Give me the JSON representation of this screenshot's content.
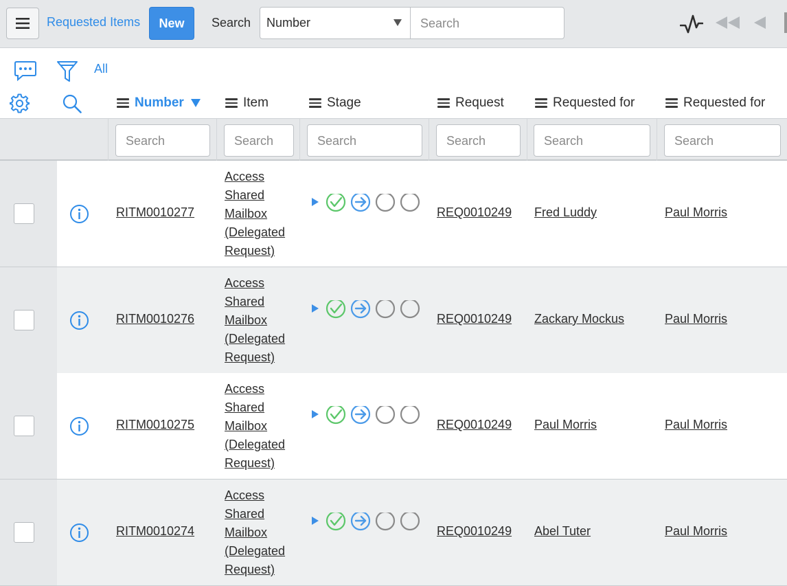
{
  "header": {
    "title": "Requested Items",
    "new_label": "New",
    "search_label": "Search",
    "field_selected": "Number",
    "search_placeholder": "Search"
  },
  "controls": {
    "all_label": "All"
  },
  "columns": [
    {
      "label": "Number",
      "sorted": "descending"
    },
    {
      "label": "Item"
    },
    {
      "label": "Stage"
    },
    {
      "label": "Request"
    },
    {
      "label": "Requested for"
    },
    {
      "label": "Requested for"
    }
  ],
  "filter_placeholder": "Search",
  "rows": [
    {
      "number": "RITM0010277",
      "item": "Access Shared Mailbox (Delegated Request)",
      "request": "REQ0010249",
      "requested_for_1": "Fred Luddy",
      "requested_for_2": "Paul Morris"
    },
    {
      "number": "RITM0010276",
      "item": "Access Shared Mailbox (Delegated Request)",
      "request": "REQ0010249",
      "requested_for_1": "Zackary Mockus",
      "requested_for_2": "Paul Morris"
    },
    {
      "number": "RITM0010275",
      "item": "Access Shared Mailbox (Delegated Request)",
      "request": "REQ0010249",
      "requested_for_1": "Paul Morris",
      "requested_for_2": "Paul Morris"
    },
    {
      "number": "RITM0010274",
      "item": "Access Shared Mailbox (Delegated Request)",
      "request": "REQ0010249",
      "requested_for_1": "Abel Tuter",
      "requested_for_2": "Paul Morris"
    }
  ],
  "colors": {
    "accent_blue": "#2f8ce8",
    "stage_complete_green": "#5cc76a",
    "stage_current_blue": "#4a9ae8",
    "stage_pending_gray": "#8a8a8a"
  },
  "icons": {
    "menu": "hamburger-icon",
    "activity": "activity-stream-icon",
    "first_page": "double-left-arrow-icon",
    "prev_page": "left-arrow-icon",
    "comments": "speech-bubble-icon",
    "filter": "funnel-icon",
    "settings": "gear-icon",
    "search": "magnifier-icon",
    "info": "info-circle-icon",
    "stage_expand": "caret-right-icon"
  }
}
